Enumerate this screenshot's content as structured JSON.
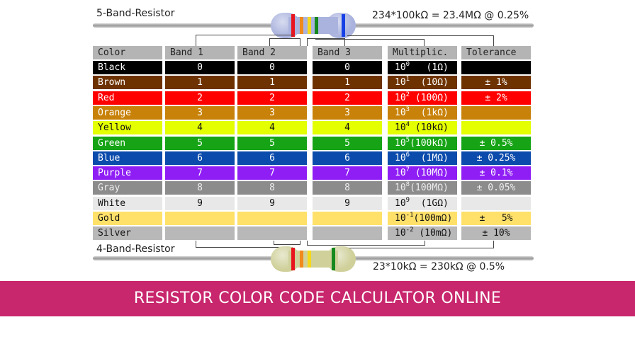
{
  "five_band": {
    "label": "5-Band-Resistor",
    "formula": "234*100kΩ = 23.4MΩ @ 0.25%",
    "body_color": "#aab3de",
    "bands": [
      {
        "role": "Band 1",
        "color": "#e8141e"
      },
      {
        "role": "Band 2",
        "color": "#ef8a1c"
      },
      {
        "role": "Band 3",
        "color": "#f5d81a"
      },
      {
        "role": "Multiplier",
        "color": "#16891e"
      },
      {
        "role": "Tolerance",
        "color": "#1640e6"
      }
    ]
  },
  "four_band": {
    "label": "4-Band-Resistor",
    "formula": "23*10kΩ = 230kΩ @ 0.5%",
    "body_color": "#cfd09a",
    "bands": [
      {
        "role": "Band 1",
        "color": "#e8141e"
      },
      {
        "role": "Band 2",
        "color": "#ef8a1c"
      },
      {
        "role": "Multiplier",
        "color": "#f5d81a"
      },
      {
        "role": "Tolerance",
        "color": "#16891e"
      }
    ]
  },
  "table": {
    "headers": [
      "Color",
      "Band 1",
      "Band 2",
      "Band 3",
      "Multiplic.",
      "Tolerance"
    ],
    "rows": [
      {
        "name": "Black",
        "bg": "#000000",
        "fg": "#ffffff",
        "b1": "0",
        "b2": "0",
        "b3": "0",
        "mult_base": "10",
        "mult_exp": "0",
        "mult_val": "   (1Ω)",
        "tol": ""
      },
      {
        "name": "Brown",
        "bg": "#6e3200",
        "fg": "#ffffff",
        "b1": "1",
        "b2": "1",
        "b3": "1",
        "mult_base": "10",
        "mult_exp": "1",
        "mult_val": "  (10Ω)",
        "tol": "± 1%"
      },
      {
        "name": "Red",
        "bg": "#ff0000",
        "fg": "#ffffff",
        "b1": "2",
        "b2": "2",
        "b3": "2",
        "mult_base": "10",
        "mult_exp": "2",
        "mult_val": " (100Ω)",
        "tol": "± 2%"
      },
      {
        "name": "Orange",
        "bg": "#c8820a",
        "fg": "#ffffff",
        "b1": "3",
        "b2": "3",
        "b3": "3",
        "mult_base": "10",
        "mult_exp": "3",
        "mult_val": "  (1kΩ)",
        "tol": ""
      },
      {
        "name": "Yellow",
        "bg": "#e4ff00",
        "fg": "#111111",
        "b1": "4",
        "b2": "4",
        "b3": "4",
        "mult_base": "10",
        "mult_exp": "4",
        "mult_val": " (10kΩ)",
        "tol": ""
      },
      {
        "name": "Green",
        "bg": "#16a416",
        "fg": "#ffffff",
        "b1": "5",
        "b2": "5",
        "b3": "5",
        "mult_base": "10",
        "mult_exp": "5",
        "mult_val": "(100kΩ)",
        "tol": "± 0.5%"
      },
      {
        "name": "Blue",
        "bg": "#0b4bac",
        "fg": "#ffffff",
        "b1": "6",
        "b2": "6",
        "b3": "6",
        "mult_base": "10",
        "mult_exp": "6",
        "mult_val": "  (1MΩ)",
        "tol": "± 0.25%"
      },
      {
        "name": "Purple",
        "bg": "#8f1ef5",
        "fg": "#ffffff",
        "b1": "7",
        "b2": "7",
        "b3": "7",
        "mult_base": "10",
        "mult_exp": "7",
        "mult_val": " (10MΩ)",
        "tol": "± 0.1%"
      },
      {
        "name": "Gray",
        "bg": "#8c8c8c",
        "fg": "#eeeeee",
        "b1": "8",
        "b2": "8",
        "b3": "8",
        "mult_base": "10",
        "mult_exp": "8",
        "mult_val": "(100MΩ)",
        "tol": "± 0.05%"
      },
      {
        "name": "White",
        "bg": "#e8e8e8",
        "fg": "#111111",
        "b1": "9",
        "b2": "9",
        "b3": "9",
        "mult_base": "10",
        "mult_exp": "9",
        "mult_val": "  (1GΩ)",
        "tol": ""
      },
      {
        "name": "Gold",
        "bg": "#ffe16a",
        "fg": "#111111",
        "b1": "",
        "b2": "",
        "b3": "",
        "mult_base": "10",
        "mult_exp": "-1",
        "mult_val": "(100mΩ)",
        "tol": "±   5%"
      },
      {
        "name": "Silver",
        "bg": "#b8b8b8",
        "fg": "#111111",
        "b1": "",
        "b2": "",
        "b3": "",
        "mult_base": "10",
        "mult_exp": "-2",
        "mult_val": " (10mΩ)",
        "tol": "± 10%"
      }
    ]
  },
  "banner": {
    "title": "RESISTOR COLOR CODE CALCULATOR ONLINE",
    "color": "#c8276d"
  }
}
